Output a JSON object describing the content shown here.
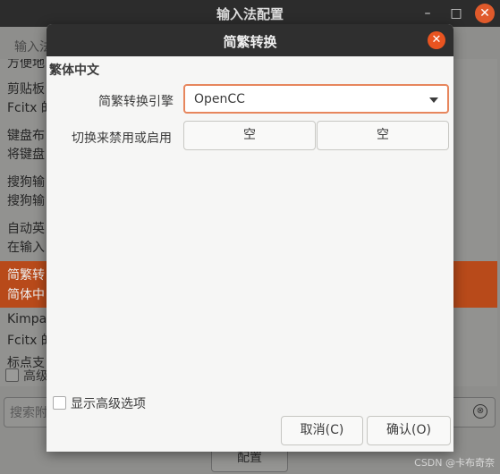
{
  "background_window": {
    "title": "输入法配置",
    "controls": {
      "minimize": "–",
      "maximize": "□",
      "close": "✕"
    },
    "tab_partial": "输入法",
    "list_items": [
      {
        "line1": "方便地",
        "line2": ""
      },
      {
        "line1": "剪贴板",
        "line2": "Fcitx 的"
      },
      {
        "line1": "键盘布",
        "line2": "将键盘"
      },
      {
        "line1": "搜狗输",
        "line2": "搜狗输"
      },
      {
        "line1": "自动英",
        "line2": "在输入"
      },
      {
        "line1": "简繁转",
        "line2": "简体中"
      },
      {
        "line1": "Kimpan",
        "line2": "Fcitx 的"
      },
      {
        "line1": "标点支",
        "line2": ""
      }
    ],
    "advanced_check_label": "高级",
    "search_placeholder": "搜索附",
    "search_clear_icon": "⊗",
    "config_button": "配置"
  },
  "dialog": {
    "title": "简繁转换",
    "close_icon": "✕",
    "section_title": "繁体中文",
    "engine_label": "简繁转换引擎",
    "engine_value": "OpenCC",
    "toggle_label": "切换来禁用或启用",
    "hotkey_1": "空",
    "hotkey_2": "空",
    "show_advanced_label": "显示高级选项",
    "cancel_label": "取消(C)",
    "ok_label": "确认(O)"
  },
  "watermark": "CSDN @卡布奇奈",
  "colors": {
    "accent": "#e95420",
    "selected_row": "#b84a1a"
  }
}
